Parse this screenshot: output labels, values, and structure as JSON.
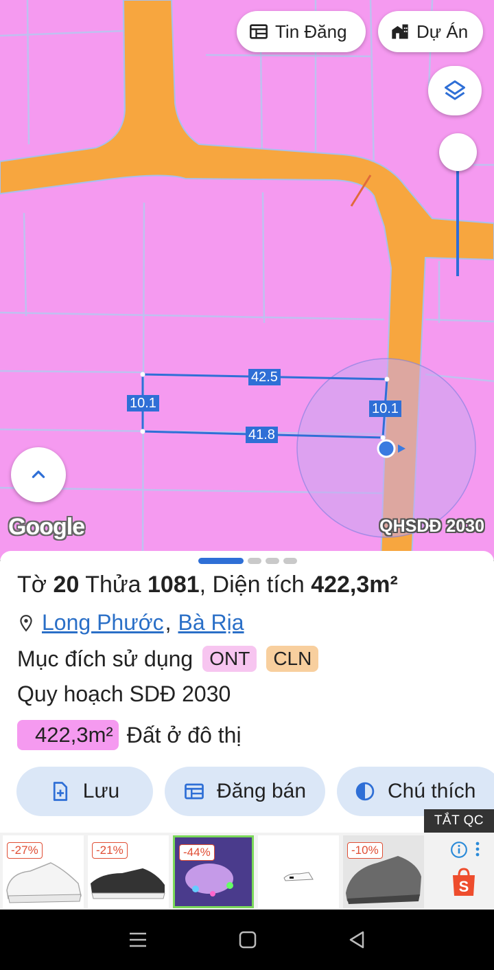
{
  "map": {
    "buttons": {
      "tin_dang": "Tin Đăng",
      "du_an": "Dự Án"
    },
    "layers_icon": "layers-icon",
    "slider_opacity_level": 0.15,
    "dimensions": {
      "top": "42.5",
      "bottom": "41.8",
      "left": "10.1",
      "right": "10.1"
    },
    "google_logo": "Google",
    "plan_label": "QHSDĐ 2030",
    "colors": {
      "land": "#f59af0",
      "road": "#f7a63f",
      "accent": "#2f6fd6"
    }
  },
  "sheet": {
    "pager": {
      "pages": 4,
      "active": 0
    },
    "title": {
      "to_label": "Tờ",
      "to_value": "20",
      "thua_label": "Thửa",
      "thua_value": "1081",
      "area_label": ", Diện tích",
      "area_value": "422,3m²"
    },
    "location": {
      "ward": "Long Phước",
      "separator": ",",
      "city": "Bà Rịa"
    },
    "purpose": {
      "label": "Mục đích sử dụng",
      "tags": [
        "ONT",
        "CLN"
      ]
    },
    "plan": "Quy hoạch SDĐ 2030",
    "area_row": {
      "value": "422,3m²",
      "desc": "Đất ở đô thị"
    },
    "actions": {
      "save": "Lưu",
      "post": "Đăng bán",
      "legend": "Chú thích"
    }
  },
  "ads": {
    "close_label": "TẮT QC",
    "items": [
      {
        "discount": "-27%"
      },
      {
        "discount": "-21%"
      },
      {
        "discount": "-44%"
      },
      {
        "discount": ""
      },
      {
        "discount": "-10%"
      }
    ],
    "brand": "shopee-icon"
  },
  "nav": {
    "icons": [
      "menu-icon",
      "home-icon",
      "back-icon"
    ]
  }
}
